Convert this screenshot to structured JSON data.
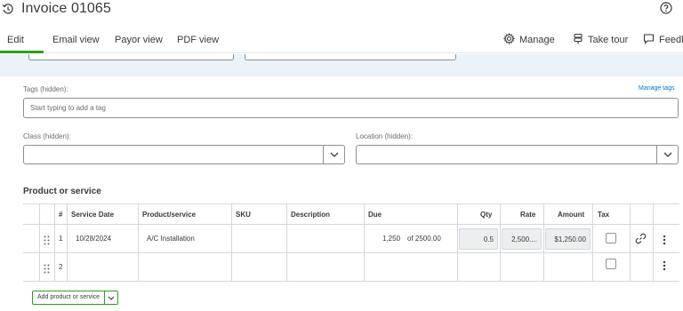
{
  "header": {
    "title": "Invoice 01065",
    "history_icon": "history-icon",
    "help_icon": "help-icon"
  },
  "tabs": [
    {
      "label": "Edit",
      "active": true
    },
    {
      "label": "Email view"
    },
    {
      "label": "Payor view"
    },
    {
      "label": "PDF view"
    }
  ],
  "toolbar": {
    "manage_label": "Manage",
    "tour_label": "Take tour",
    "feedback_label": "Feedl"
  },
  "tags": {
    "label": "Tags (hidden):",
    "manage_link": "Manage tags",
    "placeholder": "Start typing to add a tag"
  },
  "class_field": {
    "label": "Class (hidden):",
    "value": ""
  },
  "location_field": {
    "label": "Location (hidden):",
    "value": ""
  },
  "products": {
    "section_title": "Product or service",
    "columns": [
      "#",
      "Service Date",
      "Product/service",
      "SKU",
      "Description",
      "Due",
      "Qty",
      "Rate",
      "Amount",
      "Tax"
    ],
    "rows": [
      {
        "num": "1",
        "service_date": "10/28/2024",
        "product": "A/C Installation",
        "sku": "",
        "description": "",
        "due": "1,250",
        "due_of": "of 2500.00",
        "qty": "0.5",
        "rate": "2,500....",
        "amount": "$1,250.00",
        "tax": false
      },
      {
        "num": "2",
        "service_date": "",
        "product": "",
        "sku": "",
        "description": "",
        "due": "",
        "due_of": "",
        "qty": "",
        "rate": "",
        "amount": "",
        "tax": false
      }
    ],
    "add_button_label": "Add product or service"
  },
  "colors": {
    "accent_green": "#2ca01c",
    "link_blue": "#0077c5",
    "panel_bg": "#eaf3f9"
  }
}
